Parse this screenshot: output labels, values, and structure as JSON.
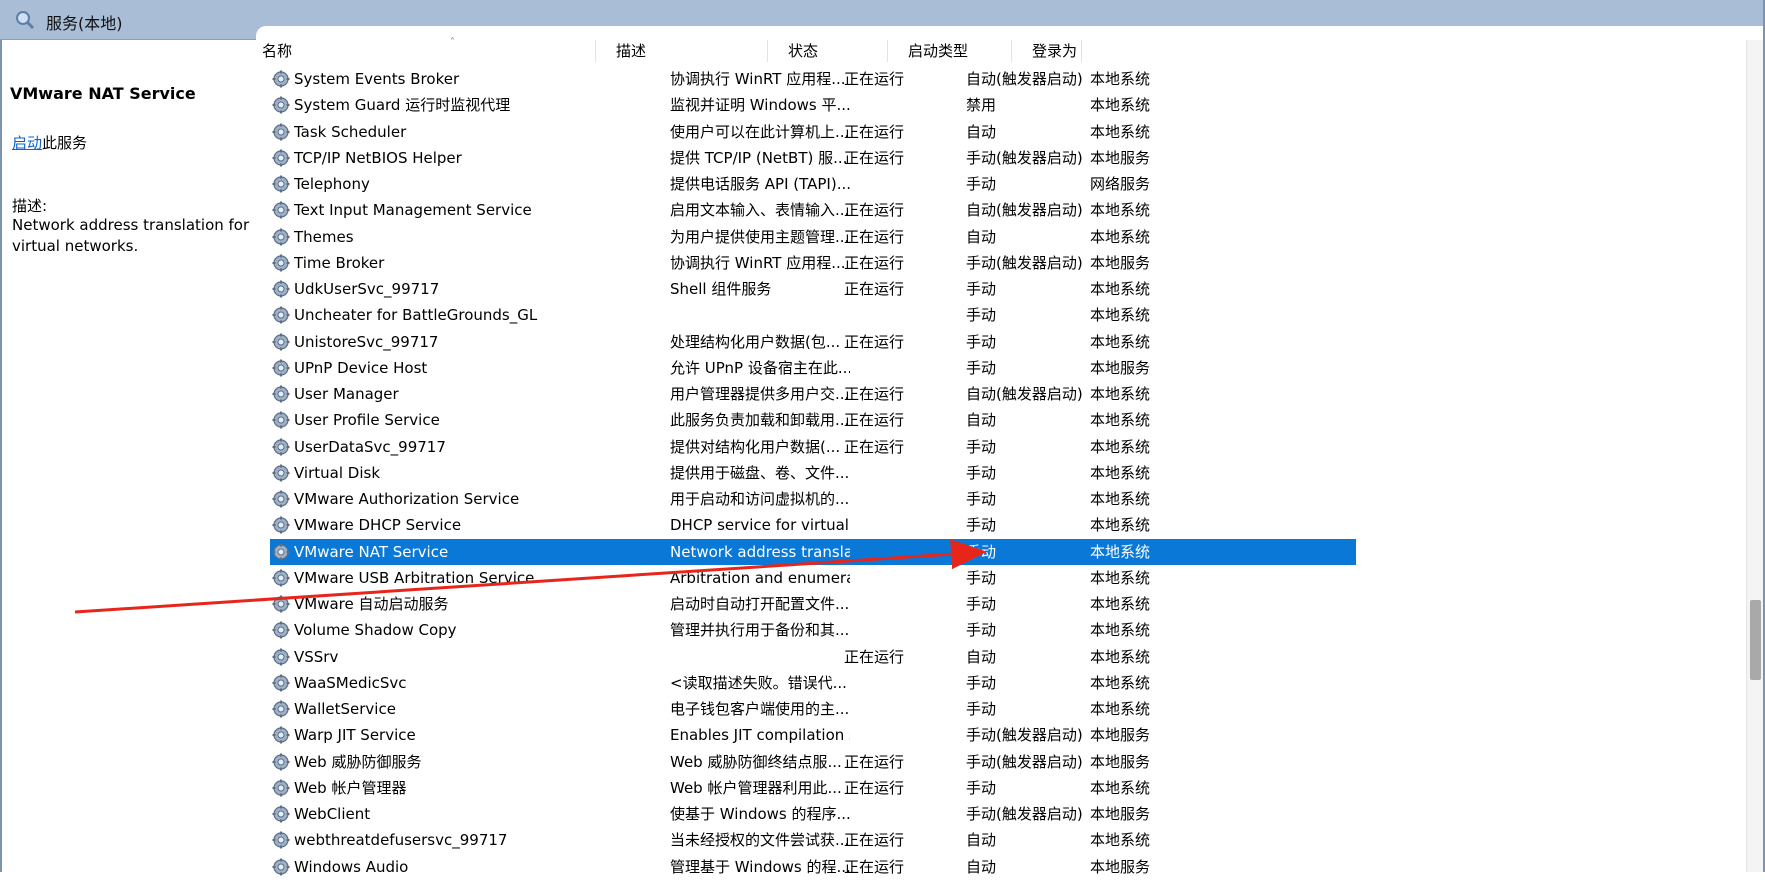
{
  "window": {
    "title": "服务(本地)"
  },
  "left": {
    "service_name": "VMware NAT Service",
    "start_link": "启动",
    "start_suffix": "此服务",
    "desc_label": "描述:",
    "desc_text": "Network address translation for virtual networks."
  },
  "columns": [
    "名称",
    "描述",
    "状态",
    "启动类型",
    "登录为"
  ],
  "rows": [
    {
      "name": "System Events Broker",
      "desc": "协调执行 WinRT 应用程...",
      "status": "正在运行",
      "start": "自动(触发器启动)",
      "logon": "本地系统"
    },
    {
      "name": "System Guard 运行时监视代理",
      "desc": "监视并证明 Windows 平...",
      "status": "",
      "start": "禁用",
      "logon": "本地系统"
    },
    {
      "name": "Task Scheduler",
      "desc": "使用户可以在此计算机上...",
      "status": "正在运行",
      "start": "自动",
      "logon": "本地系统"
    },
    {
      "name": "TCP/IP NetBIOS Helper",
      "desc": "提供 TCP/IP (NetBT) 服...",
      "status": "正在运行",
      "start": "手动(触发器启动)",
      "logon": "本地服务"
    },
    {
      "name": "Telephony",
      "desc": "提供电话服务 API (TAPI)...",
      "status": "",
      "start": "手动",
      "logon": "网络服务"
    },
    {
      "name": "Text Input Management Service",
      "desc": "启用文本输入、表情输入...",
      "status": "正在运行",
      "start": "自动(触发器启动)",
      "logon": "本地系统"
    },
    {
      "name": "Themes",
      "desc": "为用户提供使用主题管理...",
      "status": "正在运行",
      "start": "自动",
      "logon": "本地系统"
    },
    {
      "name": "Time Broker",
      "desc": "协调执行 WinRT 应用程...",
      "status": "正在运行",
      "start": "手动(触发器启动)",
      "logon": "本地服务"
    },
    {
      "name": "UdkUserSvc_99717",
      "desc": "Shell 组件服务",
      "status": "正在运行",
      "start": "手动",
      "logon": "本地系统"
    },
    {
      "name": "Uncheater for BattleGrounds_GL",
      "desc": "",
      "status": "",
      "start": "手动",
      "logon": "本地系统"
    },
    {
      "name": "UnistoreSvc_99717",
      "desc": "处理结构化用户数据(包...",
      "status": "正在运行",
      "start": "手动",
      "logon": "本地系统"
    },
    {
      "name": "UPnP Device Host",
      "desc": "允许 UPnP 设备宿主在此...",
      "status": "",
      "start": "手动",
      "logon": "本地服务"
    },
    {
      "name": "User Manager",
      "desc": "用户管理器提供多用户交...",
      "status": "正在运行",
      "start": "自动(触发器启动)",
      "logon": "本地系统"
    },
    {
      "name": "User Profile Service",
      "desc": "此服务负责加载和卸载用...",
      "status": "正在运行",
      "start": "自动",
      "logon": "本地系统"
    },
    {
      "name": "UserDataSvc_99717",
      "desc": "提供对结构化用户数据(...",
      "status": "正在运行",
      "start": "手动",
      "logon": "本地系统"
    },
    {
      "name": "Virtual Disk",
      "desc": "提供用于磁盘、卷、文件...",
      "status": "",
      "start": "手动",
      "logon": "本地系统"
    },
    {
      "name": "VMware Authorization Service",
      "desc": "用于启动和访问虚拟机的...",
      "status": "",
      "start": "手动",
      "logon": "本地系统"
    },
    {
      "name": "VMware DHCP Service",
      "desc": "DHCP service for virtual ...",
      "status": "",
      "start": "手动",
      "logon": "本地系统"
    },
    {
      "name": "VMware NAT Service",
      "desc": "Network address translat...",
      "status": "",
      "start": "手动",
      "logon": "本地系统",
      "selected": true
    },
    {
      "name": "VMware USB Arbitration Service",
      "desc": "Arbitration and enumera...",
      "status": "",
      "start": "手动",
      "logon": "本地系统"
    },
    {
      "name": "VMware 自动启动服务",
      "desc": "启动时自动打开配置文件...",
      "status": "",
      "start": "手动",
      "logon": "本地系统"
    },
    {
      "name": "Volume Shadow Copy",
      "desc": "管理并执行用于备份和其...",
      "status": "",
      "start": "手动",
      "logon": "本地系统"
    },
    {
      "name": "VSSrv",
      "desc": "",
      "status": "正在运行",
      "start": "自动",
      "logon": "本地系统"
    },
    {
      "name": "WaaSMedicSvc",
      "desc": "<读取描述失败。错误代...",
      "status": "",
      "start": "手动",
      "logon": "本地系统"
    },
    {
      "name": "WalletService",
      "desc": "电子钱包客户端使用的主...",
      "status": "",
      "start": "手动",
      "logon": "本地系统"
    },
    {
      "name": "Warp JIT Service",
      "desc": "Enables JIT compilation s...",
      "status": "",
      "start": "手动(触发器启动)",
      "logon": "本地服务"
    },
    {
      "name": "Web 威胁防御服务",
      "desc": "Web 威胁防御终结点服...",
      "status": "正在运行",
      "start": "手动(触发器启动)",
      "logon": "本地服务"
    },
    {
      "name": "Web 帐户管理器",
      "desc": "Web 帐户管理器利用此...",
      "status": "正在运行",
      "start": "手动",
      "logon": "本地系统"
    },
    {
      "name": "WebClient",
      "desc": "使基于 Windows 的程序...",
      "status": "",
      "start": "手动(触发器启动)",
      "logon": "本地服务"
    },
    {
      "name": "webthreatdefusersvc_99717",
      "desc": "当未经授权的文件尝试获...",
      "status": "正在运行",
      "start": "自动",
      "logon": "本地系统"
    },
    {
      "name": "Windows Audio",
      "desc": "管理基于 Windows 的程...",
      "status": "正在运行",
      "start": "自动",
      "logon": "本地服务"
    }
  ],
  "colors": {
    "selection": "#0a78d7",
    "link": "#0b63c9",
    "annotation_arrow": "#e8251b"
  }
}
